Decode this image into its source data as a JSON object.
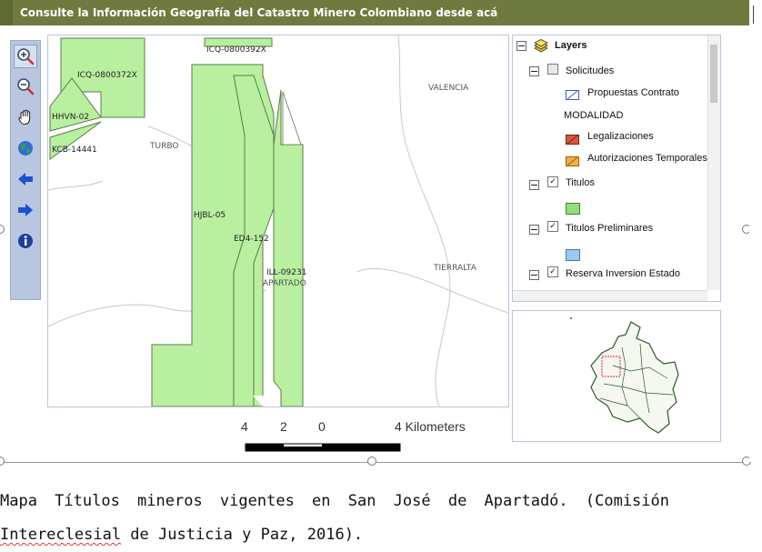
{
  "titlebar": {
    "title": "Consulte la Información Geografía del Catastro Minero Colombiano desde acá"
  },
  "toolbar": {
    "tools": [
      "zoom-in-icon",
      "zoom-out-icon",
      "pan-hand-icon",
      "globe-full-extent-icon",
      "arrow-back-icon",
      "arrow-forward-icon",
      "info-icon"
    ]
  },
  "map": {
    "polygon_labels": [
      "ICQ-0800392X",
      "ICQ-0800372X",
      "HHVN-02",
      "KCB-14441",
      "HJBL-05",
      "ED4-152",
      "ILL-09231"
    ],
    "place_labels": [
      "VALENCIA",
      "TURBO",
      "TIERRALTA",
      "APARTADO"
    ],
    "colors": {
      "titulo_fill": "#b9f0a0",
      "titulo_stroke": "#4a6a3a",
      "boundary": "#c0c0c0"
    }
  },
  "scalebar": {
    "ticks": [
      "4",
      "2",
      "0",
      "4 Kilometers"
    ]
  },
  "layers": {
    "root": "Layers",
    "items": [
      {
        "label": "Solicitudes",
        "checked": false
      },
      {
        "label": "Propuestas Contrato"
      },
      {
        "label": "MODALIDAD"
      },
      {
        "label": "Legalizaciones"
      },
      {
        "label": "Autorizaciones Temporales"
      },
      {
        "label": "Titulos",
        "checked": true
      },
      {
        "label": "Titulos Preliminares",
        "checked": true
      },
      {
        "label": "Reserva Inversion Estado",
        "checked": true
      }
    ],
    "colors": {
      "propuestas": "#3b5fb0",
      "legalizaciones": "#c0392b",
      "autorizaciones": "#f0a020",
      "titulos": "#8fe07a",
      "titulos_preliminares": "#9cc8ee"
    }
  },
  "caption": {
    "line1": "Mapa Títulos mineros vigentes en San José de Apartadó. (Comisión",
    "line2_a": "Intereclesial",
    "line2_b": " de Justicia y Paz, 2016)."
  }
}
